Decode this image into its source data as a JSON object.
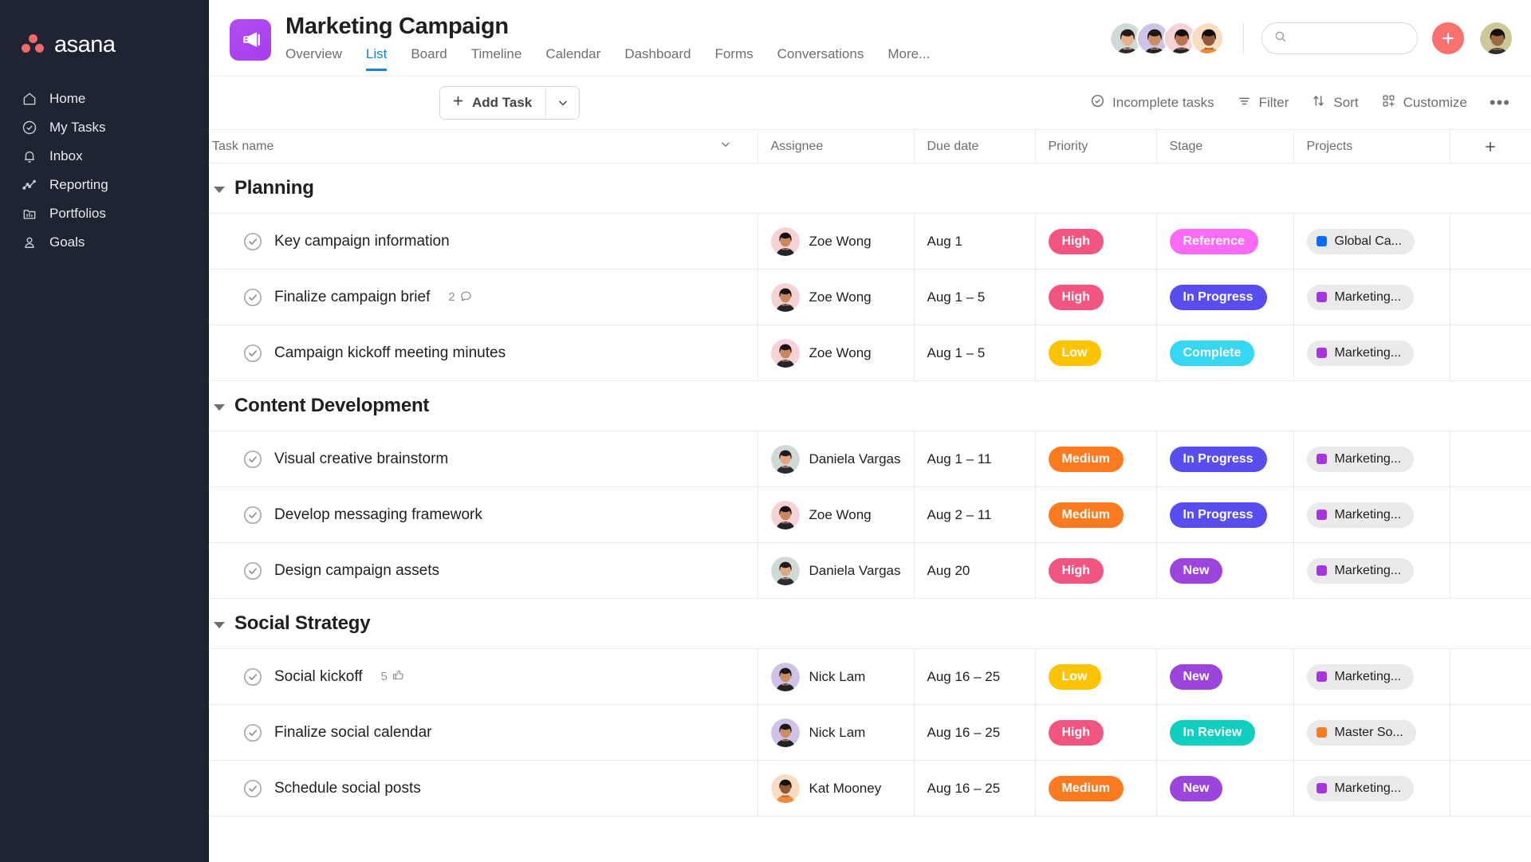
{
  "sidebar": {
    "brand": "asana",
    "items": [
      {
        "label": "Home",
        "icon": "home-icon"
      },
      {
        "label": "My Tasks",
        "icon": "check-circle-icon"
      },
      {
        "label": "Inbox",
        "icon": "bell-icon"
      },
      {
        "label": "Reporting",
        "icon": "line-chart-icon"
      },
      {
        "label": "Portfolios",
        "icon": "portfolio-icon"
      },
      {
        "label": "Goals",
        "icon": "goal-target-icon"
      }
    ]
  },
  "header": {
    "project_title": "Marketing Campaign",
    "project_icon": "megaphone-icon",
    "project_icon_color": "#a83df0",
    "tabs": [
      {
        "label": "Overview",
        "active": false
      },
      {
        "label": "List",
        "active": true
      },
      {
        "label": "Board",
        "active": false
      },
      {
        "label": "Timeline",
        "active": false
      },
      {
        "label": "Calendar",
        "active": false
      },
      {
        "label": "Dashboard",
        "active": false
      },
      {
        "label": "Forms",
        "active": false
      },
      {
        "label": "Conversations",
        "active": false
      },
      {
        "label": "More...",
        "active": false
      }
    ],
    "active_tab_color": "#1a7fe8",
    "members": [
      {
        "name": "member-1",
        "bg": "#cfd9d8",
        "skin": "#e8b08a",
        "hair": "#231c1a",
        "shirt": "#2b2b33"
      },
      {
        "name": "member-2",
        "bg": "#cfc4e8",
        "skin": "#c98f63",
        "hair": "#1e1713",
        "shirt": "#222228"
      },
      {
        "name": "member-3",
        "bg": "#f6d2d6",
        "skin": "#b9764c",
        "hair": "#171012",
        "shirt": "#23232a"
      },
      {
        "name": "member-4",
        "bg": "#fadcc0",
        "skin": "#8e5b3a",
        "hair": "#120c0c",
        "shirt": "#f08a3c"
      }
    ],
    "search_placeholder": "",
    "search_value": "",
    "add_button_label": "+",
    "add_button_color": "#f8716f",
    "current_user_avatar": {
      "bg": "#cdc898",
      "skin": "#9d6a45",
      "hair": "#16100d",
      "shirt": "#2d2d33"
    }
  },
  "toolbar": {
    "add_task_label": "Add Task",
    "incomplete_tasks_label": "Incomplete tasks",
    "filter_label": "Filter",
    "sort_label": "Sort",
    "customize_label": "Customize",
    "overflow_label": "•••"
  },
  "table": {
    "columns": [
      {
        "key": "task_name",
        "label": "Task name"
      },
      {
        "key": "assignee",
        "label": "Assignee"
      },
      {
        "key": "due_date",
        "label": "Due date"
      },
      {
        "key": "priority",
        "label": "Priority"
      },
      {
        "key": "stage",
        "label": "Stage"
      },
      {
        "key": "projects",
        "label": "Projects"
      }
    ],
    "add_column_label": "+"
  },
  "priority_colors": {
    "High": "#f2557f",
    "Medium": "#fb7b21",
    "Low": "#fcc400"
  },
  "stage_colors": {
    "Reference": "#fc6bf6",
    "In Progress": "#5a4df0",
    "Complete": "#35d7f2",
    "New": "#9b45dd",
    "In Review": "#10cfc0"
  },
  "project_colors": {
    "Global Ca...": "#0a6cff",
    "Marketing...": "#a833e0",
    "Master So...": "#fb7b21"
  },
  "sections": [
    {
      "title": "Planning",
      "tasks": [
        {
          "name": "Key campaign information",
          "meta_count": "",
          "meta_icon": "",
          "assignee": "Zoe Wong",
          "avatar": {
            "bg": "#f6d2d6",
            "skin": "#c98760",
            "hair": "#171012",
            "shirt": "#23232a"
          },
          "due_date": "Aug 1",
          "priority": "High",
          "stage": "Reference",
          "project": "Global Ca..."
        },
        {
          "name": "Finalize campaign brief",
          "meta_count": "2",
          "meta_icon": "comment-icon",
          "assignee": "Zoe Wong",
          "avatar": {
            "bg": "#f6d2d6",
            "skin": "#c98760",
            "hair": "#171012",
            "shirt": "#23232a"
          },
          "due_date": "Aug 1 – 5",
          "priority": "High",
          "stage": "In Progress",
          "project": "Marketing..."
        },
        {
          "name": "Campaign kickoff meeting minutes",
          "meta_count": "",
          "meta_icon": "",
          "assignee": "Zoe Wong",
          "avatar": {
            "bg": "#f6d2d6",
            "skin": "#c98760",
            "hair": "#171012",
            "shirt": "#23232a"
          },
          "due_date": "Aug 1 – 5",
          "priority": "Low",
          "stage": "Complete",
          "project": "Marketing..."
        }
      ]
    },
    {
      "title": "Content Development",
      "tasks": [
        {
          "name": "Visual creative brainstorm",
          "meta_count": "",
          "meta_icon": "",
          "assignee": "Daniela Vargas",
          "avatar": {
            "bg": "#cfd9d8",
            "skin": "#e0a87f",
            "hair": "#241b18",
            "shirt": "#2b2b33"
          },
          "due_date": "Aug 1 – 11",
          "priority": "Medium",
          "stage": "In Progress",
          "project": "Marketing..."
        },
        {
          "name": "Develop messaging framework",
          "meta_count": "",
          "meta_icon": "",
          "assignee": "Zoe Wong",
          "avatar": {
            "bg": "#f6d2d6",
            "skin": "#c98760",
            "hair": "#171012",
            "shirt": "#23232a"
          },
          "due_date": "Aug 2 – 11",
          "priority": "Medium",
          "stage": "In Progress",
          "project": "Marketing..."
        },
        {
          "name": "Design campaign assets",
          "meta_count": "",
          "meta_icon": "",
          "assignee": "Daniela Vargas",
          "avatar": {
            "bg": "#cfd9d8",
            "skin": "#e0a87f",
            "hair": "#241b18",
            "shirt": "#2b2b33"
          },
          "due_date": "Aug 20",
          "priority": "High",
          "stage": "New",
          "project": "Marketing..."
        }
      ]
    },
    {
      "title": "Social Strategy",
      "tasks": [
        {
          "name": "Social kickoff",
          "meta_count": "5",
          "meta_icon": "thumbs-up-icon",
          "assignee": "Nick Lam",
          "avatar": {
            "bg": "#cfc4e8",
            "skin": "#c98f63",
            "hair": "#1e1713",
            "shirt": "#222228"
          },
          "due_date": "Aug 16 – 25",
          "priority": "Low",
          "stage": "New",
          "project": "Marketing..."
        },
        {
          "name": "Finalize social calendar",
          "meta_count": "",
          "meta_icon": "",
          "assignee": "Nick Lam",
          "avatar": {
            "bg": "#cfc4e8",
            "skin": "#c98f63",
            "hair": "#1e1713",
            "shirt": "#222228"
          },
          "due_date": "Aug 16 – 25",
          "priority": "High",
          "stage": "In Review",
          "project": "Master So..."
        },
        {
          "name": "Schedule social posts",
          "meta_count": "",
          "meta_icon": "",
          "assignee": "Kat Mooney",
          "avatar": {
            "bg": "#fadcc0",
            "skin": "#8e5b3a",
            "hair": "#120c0c",
            "shirt": "#f08a3c"
          },
          "due_date": "Aug 16 – 25",
          "priority": "Medium",
          "stage": "New",
          "project": "Marketing..."
        }
      ]
    }
  ]
}
